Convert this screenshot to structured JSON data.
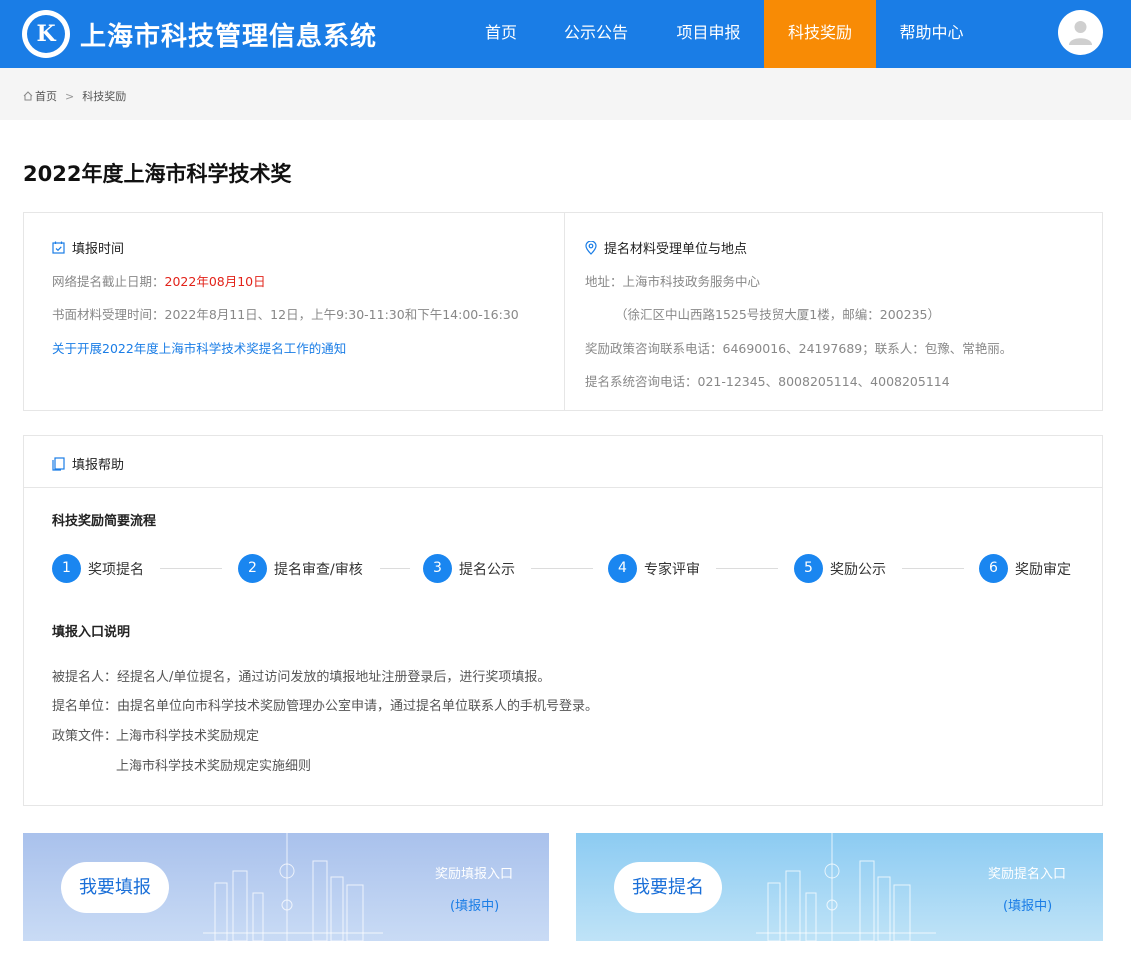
{
  "header": {
    "logo_letter": "K",
    "site_title": "上海市科技管理信息系统",
    "nav": [
      {
        "label": "首页",
        "active": false
      },
      {
        "label": "公示公告",
        "active": false
      },
      {
        "label": "项目申报",
        "active": false
      },
      {
        "label": "科技奖励",
        "active": true
      },
      {
        "label": "帮助中心",
        "active": false
      }
    ],
    "accent_color": "#1a7de6",
    "active_color": "#f88b05"
  },
  "breadcrumb": {
    "home": "首页",
    "separator": ">",
    "current": "科技奖励"
  },
  "page_title": "2022年度上海市科学技术奖",
  "fill_time": {
    "heading": "填报时间",
    "deadline_label": "网络提名截止日期：",
    "deadline_value": "2022年08月10日",
    "paper_label": "书面材料受理时间：",
    "paper_value": "2022年8月11日、12日，上午9:30-11:30和下午14:00-16:30",
    "notice_link": "关于开展2022年度上海市科学技术奖提名工作的通知"
  },
  "location": {
    "heading": "提名材料受理单位与地点",
    "address": "地址：上海市科技政务服务中心",
    "address_detail": "（徐汇区中山西路1525号技贸大厦1楼，邮编：200235）",
    "policy_phone": "奖励政策咨询联系电话：64690016、24197689；联系人：包豫、常艳丽。",
    "system_phone": "提名系统咨询电话：021-12345、8008205114、4008205114"
  },
  "help": {
    "heading": "填报帮助",
    "process_title": "科技奖励简要流程",
    "steps": [
      {
        "num": "1",
        "label": "奖项提名"
      },
      {
        "num": "2",
        "label": "提名审查/审核"
      },
      {
        "num": "3",
        "label": "提名公示"
      },
      {
        "num": "4",
        "label": "专家评审"
      },
      {
        "num": "5",
        "label": "奖励公示"
      },
      {
        "num": "6",
        "label": "奖励审定"
      }
    ],
    "entry_title": "填报入口说明",
    "nominee": "被提名人：经提名人/单位提名，通过访问发放的填报地址注册登录后，进行奖项填报。",
    "unit": "提名单位：由提名单位向市科学技术奖励管理办公室申请，通过提名单位联系人的手机号登录。",
    "policy_label": "政策文件：",
    "policy_links": [
      "上海市科学技术奖励规定",
      "上海市科学技术奖励规定实施细则"
    ]
  },
  "banners": [
    {
      "button": "我要填报",
      "title": "奖励填报入口",
      "status": "(填报中)"
    },
    {
      "button": "我要提名",
      "title": "奖励提名入口",
      "status": "(填报中)"
    }
  ]
}
